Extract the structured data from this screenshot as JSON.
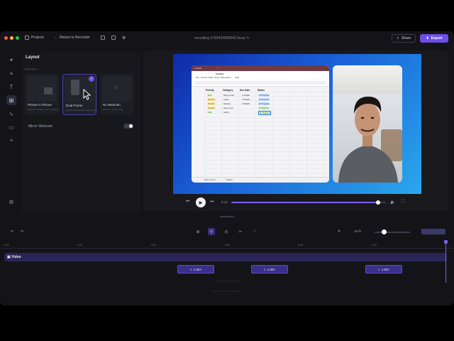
{
  "topbar": {
    "projects_label": "Projects",
    "return_label": "Return to Recorder",
    "filename": "recording-1783434900642.focus",
    "share_label": "Share",
    "export_label": "Export"
  },
  "layout_panel": {
    "title": "Layout",
    "preset_label": "PRESET",
    "cards": [
      {
        "name": "Picture in Picture",
        "desc": "webcam overlay on your content"
      },
      {
        "name": "Dual Frame",
        "desc": "screen and webcam side by side"
      },
      {
        "name": "No Webcam",
        "desc": "focus on content only"
      }
    ],
    "mirror_label": "Mirror Webcam",
    "mirror_on": true
  },
  "spreadsheet": {
    "tab_title": "Untitled",
    "menu": [
      "File",
      "Format",
      "Data",
      "Tools",
      "Extensions",
      "Help"
    ],
    "headers": [
      "Priority",
      "Category",
      "Due Date",
      "Status"
    ],
    "rows": [
      {
        "priority": "Low",
        "category": "Reply email",
        "due": "7/1/2026",
        "status": "In Progress"
      },
      {
        "priority": "Medium",
        "category": "Admin",
        "due": "7/7/2026",
        "status": "In Progress"
      },
      {
        "priority": "Medium",
        "category": "Meeting",
        "due": "7/9/2026",
        "status": "In Progress"
      },
      {
        "priority": "Medium",
        "category": "Deep work",
        "due": "",
        "status": "No Session"
      },
      {
        "priority": "Low",
        "category": "Admin",
        "due": "",
        "status": "No Session"
      }
    ],
    "sheet_tabs": [
      "Work Hours",
      "Tracker"
    ]
  },
  "player": {
    "current_time": "0:12",
    "progress": 0.95
  },
  "timeline": {
    "zoom_level": "16 fit",
    "ticks": [
      "0:00",
      "0:02",
      "0:04",
      "0:06",
      "0:08",
      "0:10"
    ],
    "video_label": "Video",
    "zoom_clips": [
      "1.80×",
      "1.80×",
      "1.80×"
    ],
    "ghost_lines": [
      "Drag to add zoom",
      "Click to add a segment"
    ]
  },
  "colors": {
    "accent": "#6d4ee6",
    "background": "#141418",
    "panel": "#17171c",
    "canvas_gradient_start": "#0f2aa8",
    "canvas_gradient_end": "#2aa8ec"
  }
}
